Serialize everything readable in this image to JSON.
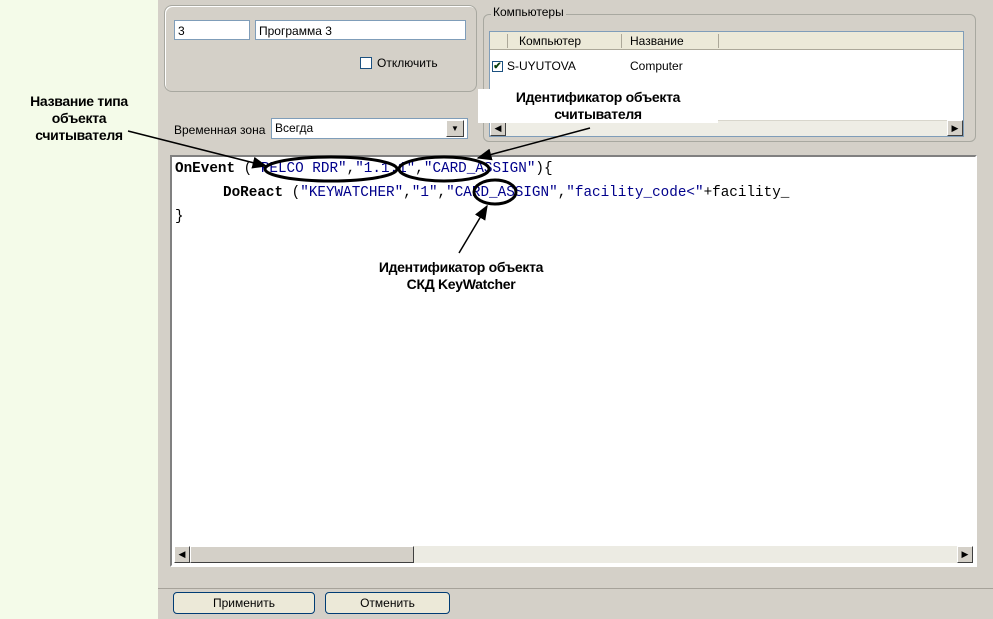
{
  "program": {
    "id_value": "3",
    "name_value": "Программа 3",
    "disable_label": "Отключить"
  },
  "computers": {
    "legend": "Компьютеры",
    "columns": [
      "Компьютер",
      "Название"
    ],
    "rows": [
      {
        "checked": "✔",
        "computer": "S-UYUTOVA",
        "name": "Computer"
      }
    ]
  },
  "timezone": {
    "label": "Временная зона",
    "value": "Всегда"
  },
  "code": {
    "l1_a": "OnEvent",
    "l1_b": " (",
    "l1_c": "\"PELCO RDR\"",
    "l1_d": ",",
    "l1_e": "\"1.1.1\"",
    "l1_f": ",",
    "l1_g": "\"CARD_ASSIGN\"",
    "l1_h": "){",
    "l2_a": "DoReact",
    "l2_b": " (",
    "l2_c": "\"KEYWATCHER\"",
    "l2_d": ",",
    "l2_e": "\"1\"",
    "l2_f": ",",
    "l2_g": "\"CARD_ASSIGN\"",
    "l2_h": ",",
    "l2_i": "\"facility_code<\"",
    "l2_j": "+facility_",
    "l3": "}"
  },
  "buttons": {
    "apply": "Применить",
    "cancel": "Отменить"
  },
  "annotations": {
    "reader_type": [
      "Название типа",
      "объекта",
      "считывателя"
    ],
    "reader_id": [
      "Идентификатор объекта",
      "считывателя"
    ],
    "keywatcher_id": [
      "Идентификатор объекта",
      "СКД KeyWatcher"
    ]
  },
  "icons": {
    "scroll_left": "◀",
    "scroll_right": "▶",
    "dropdown": "▼"
  }
}
